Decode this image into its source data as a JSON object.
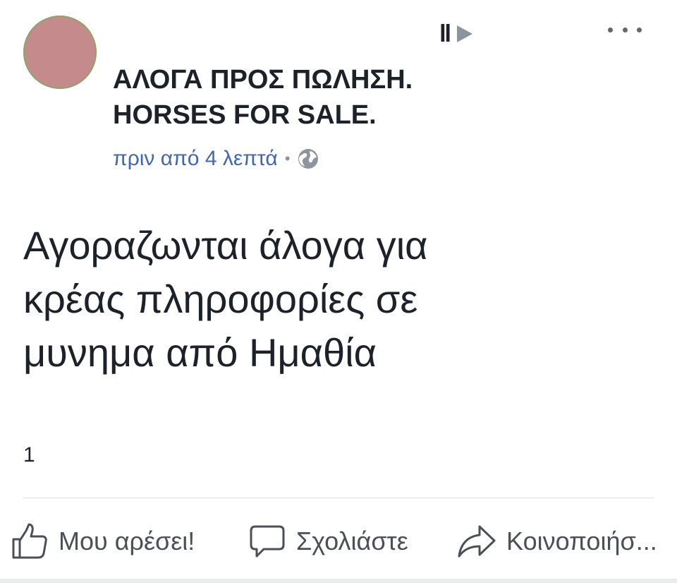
{
  "post": {
    "author_name": "",
    "group_name_line1": "ΑΛΟΓΑ ΠΡΟΣ ΠΩΛΗΣΗ.",
    "group_name_line2": "HORSES FOR SALE.",
    "timestamp": "πριν από 4 λεπτά",
    "separator": "•",
    "privacy_icon": "globe-icon",
    "text_lines": [
      "Αγοραζωνται  άλογα για",
      "κρέας πληροφορίες σε",
      "μυνημα από Ημαθία"
    ],
    "reaction_count": "1"
  },
  "actions": {
    "like_label": "Μου αρέσει!",
    "comment_label": "Σχολιάστε",
    "share_label": "Κοινοποιήσ..."
  },
  "colors": {
    "link": "#4267b2",
    "text": "#1d2129",
    "muted": "#8d949e",
    "action": "#4b4f56",
    "avatar": "#c48a8c"
  }
}
